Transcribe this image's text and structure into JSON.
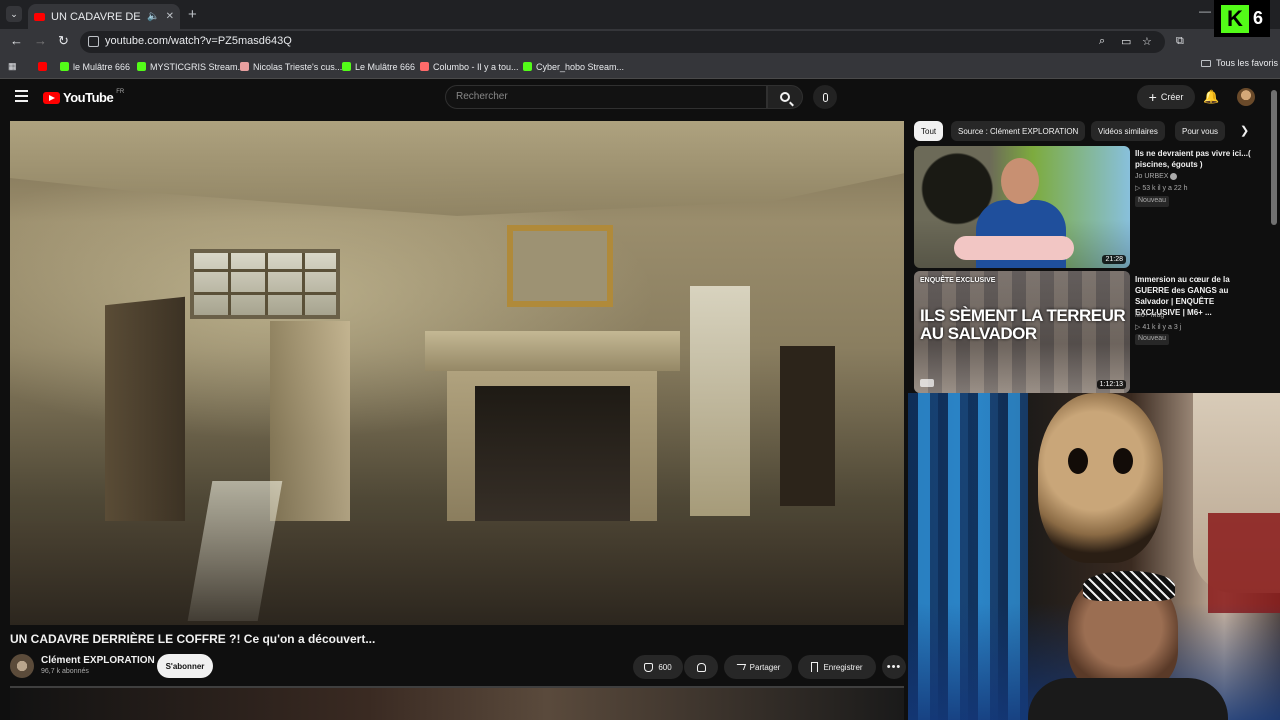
{
  "browser": {
    "tab_title": "UN CADAVRE DERRIÈRE LE",
    "new_tab": "+",
    "url": "youtube.com/watch?v=PZ5masd643Q",
    "bookmarks": [
      {
        "label": "le Mulâtre 666",
        "color": "#53fc18"
      },
      {
        "label": "MYSTICGRIS Stream...",
        "color": "#53fc18"
      },
      {
        "label": "Nicolas Trieste's cus...",
        "color": "#e8a0a0"
      },
      {
        "label": "Le Mulâtre 666",
        "color": "#53fc18"
      },
      {
        "label": "Columbo - Il y a tou...",
        "color": "#ff6a6a"
      },
      {
        "label": "Cyber_hobo Stream...",
        "color": "#53fc18"
      }
    ],
    "all_favorites": "Tous les favoris"
  },
  "overlay_badge": {
    "letter": "K",
    "number": "6",
    "color": "#53fc18"
  },
  "youtube": {
    "logo_text": "YouTube",
    "region": "FR",
    "search_placeholder": "Rechercher",
    "create_label": "Créer"
  },
  "video": {
    "title": "UN CADAVRE DERRIÈRE LE COFFRE ?! Ce qu'on a découvert...",
    "channel": "Clément EXPLORATION",
    "subscribers": "96,7 k abonnés",
    "subscribe_label": "S'abonner",
    "likes": "600",
    "share_label": "Partager",
    "save_label": "Enregistrer"
  },
  "chips": [
    "Tout",
    "Source : Clément EXPLORATION",
    "Vidéos similaires",
    "Pour vous"
  ],
  "recommendations": [
    {
      "title": "Ils ne devraient pas vivre ici...( piscines, égouts )",
      "channel": "Jo URBEX",
      "verified": true,
      "meta": "▷ 53 k  il y a 22 h",
      "badge": "Nouveau",
      "duration": "21:28"
    },
    {
      "title": "Immersion au cœur de la GUERRE des GANGS au Salvador | ENQUÊTE EXCLUSIVE | M6+ ...",
      "channel": "M6+ Mag",
      "meta": "▷ 41 k  il y a 3 j",
      "badge": "Nouveau",
      "duration": "1:12:13",
      "thumb_tag": "ENQUÊTE EXCLUSIVE",
      "thumb_text": "ILS SÈMENT LA TERREUR AU SALVADOR"
    }
  ]
}
